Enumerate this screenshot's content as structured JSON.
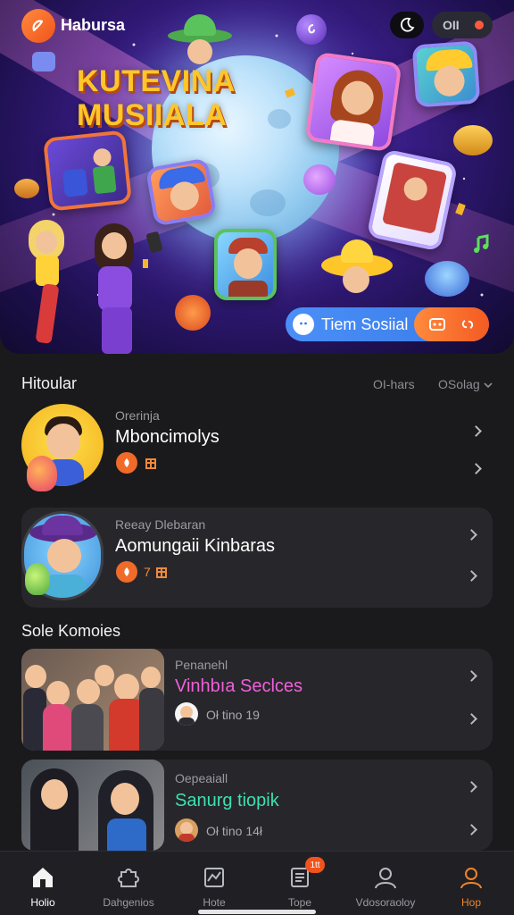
{
  "header": {
    "app_name": "Habursa",
    "toggle_label": "OII"
  },
  "hero": {
    "title_line1": "KUTEVINA",
    "title_line2": "MUSIIALA",
    "pill_label": "Tiem Sosiial"
  },
  "section1": {
    "title": "Hitoular",
    "filter1": "OI-hars",
    "filter2": "OSolag",
    "items": [
      {
        "subtitle": "Orerinja",
        "title": "Mboncimolys",
        "meta": ""
      },
      {
        "subtitle": "Reeay Dlebaran",
        "title": "Aomungaii Kinbaras",
        "meta": "7"
      }
    ]
  },
  "section2": {
    "title": "Sole Komoies",
    "items": [
      {
        "subtitle": "Penanehl",
        "title": "Vinhbıa Seclces",
        "meta": "Oł tino 19",
        "accent": "#f060d8"
      },
      {
        "subtitle": "Oepeaiall",
        "title": "Sanurg tiopik",
        "meta": "Oł tino 14ł",
        "accent": "#3ee0b0"
      }
    ]
  },
  "nav": {
    "badge": "1tt",
    "items": [
      {
        "label": "Holio",
        "icon": "home-icon",
        "active": true
      },
      {
        "label": "Dahgenios",
        "icon": "puzzle-icon",
        "active": false
      },
      {
        "label": "Hote",
        "icon": "chart-icon",
        "active": false
      },
      {
        "label": "Tope",
        "icon": "document-icon",
        "active": false
      },
      {
        "label": "Vdosoraoloy",
        "icon": "person-icon",
        "active": false
      },
      {
        "label": "Hop",
        "icon": "profile-icon",
        "active": false
      }
    ]
  },
  "colors": {
    "accent": "#f0531c",
    "card": "#27272b",
    "background": "#1a1a1c"
  }
}
